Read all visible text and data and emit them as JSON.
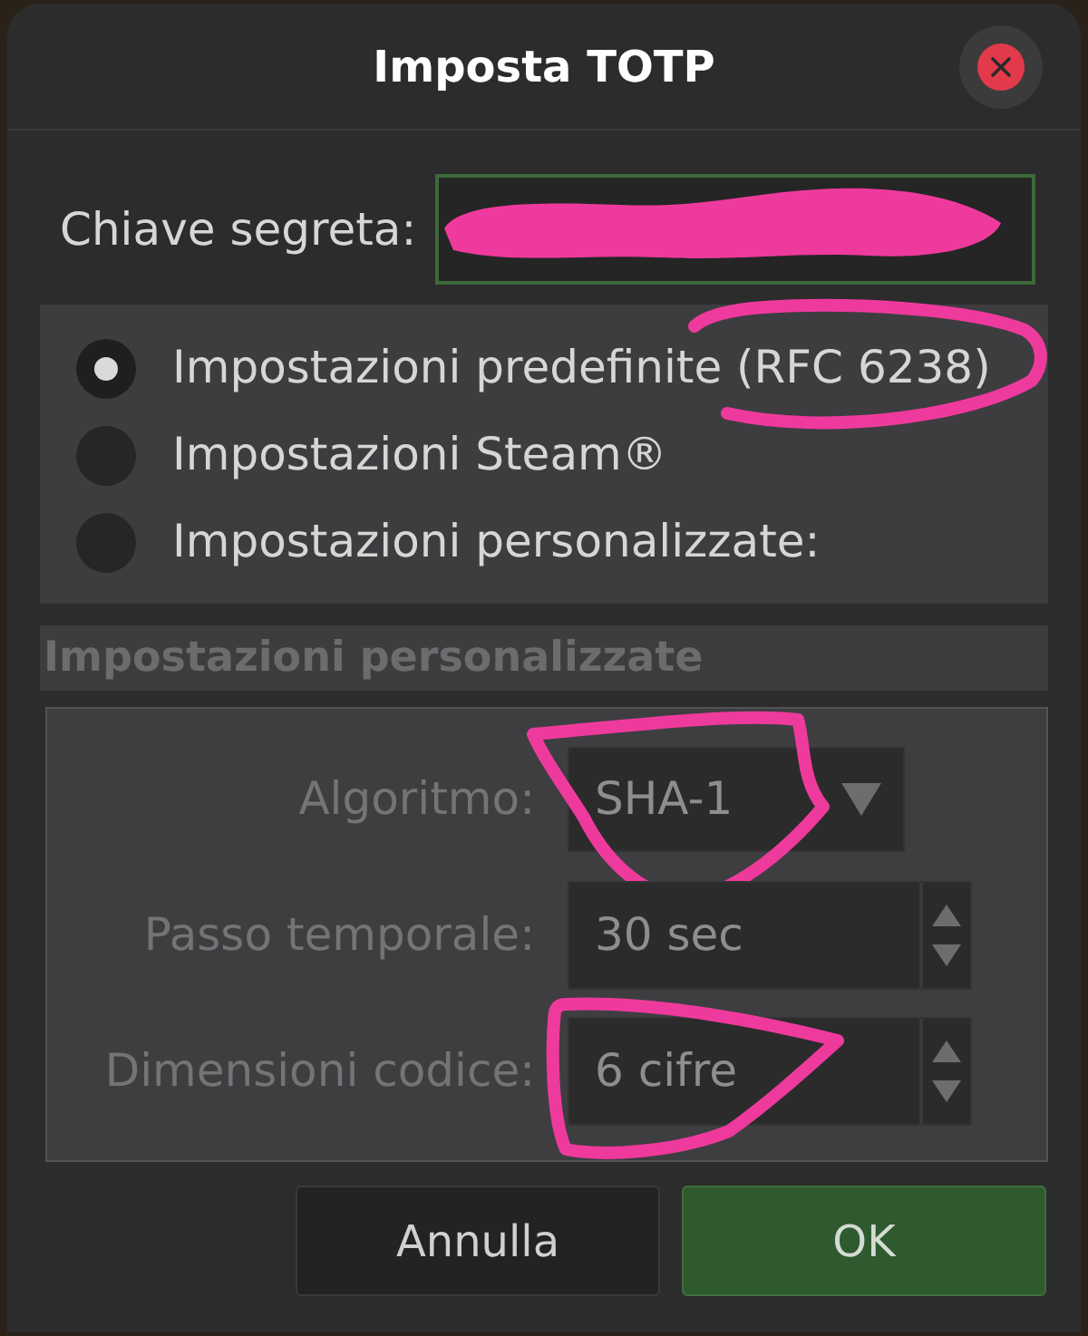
{
  "dialog": {
    "title": "Imposta TOTP"
  },
  "secret_key": {
    "label": "Chiave segreta:",
    "redacted": true
  },
  "presets": [
    {
      "label": "Impostazioni predefinite (RFC 6238)",
      "selected": true,
      "circled": true
    },
    {
      "label": "Impostazioni Steam®",
      "selected": false,
      "circled": false
    },
    {
      "label": "Impostazioni personalizzate:",
      "selected": false,
      "circled": false
    }
  ],
  "custom": {
    "title": "Impostazioni personalizzate",
    "disabled": true,
    "fields": [
      {
        "kind": "dropdown",
        "label": "Algoritmo:",
        "value": "SHA-1",
        "circled": true
      },
      {
        "kind": "spinner",
        "label": "Passo temporale:",
        "value": "30 sec",
        "circled": false
      },
      {
        "kind": "spinner",
        "label": "Dimensioni codice:",
        "value": "6 cifre",
        "circled": true
      }
    ]
  },
  "buttons": [
    {
      "label": "Annulla",
      "kind": "secondary"
    },
    {
      "label": "OK",
      "kind": "primary"
    }
  ]
}
